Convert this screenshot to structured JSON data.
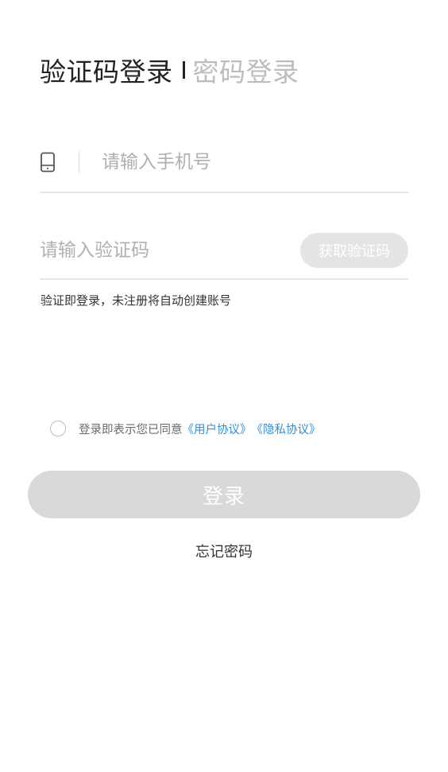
{
  "tabs": {
    "active": "验证码登录",
    "inactive": "密码登录"
  },
  "phone": {
    "icon": "phone-icon",
    "placeholder": "请输入手机号",
    "value": ""
  },
  "code": {
    "placeholder": "请输入验证码",
    "value": "",
    "get_code_label": "获取验证码"
  },
  "hint": "验证即登录，未注册将自动创建账号",
  "agreement": {
    "checked": false,
    "text": "登录即表示您已同意",
    "user_agreement": "《用户协议》",
    "privacy_agreement": "《隐私协议》"
  },
  "login_label": "登录",
  "forgot_label": "忘记密码",
  "colors": {
    "link": "#2f8fd8",
    "button_disabled": "#d9d9d9",
    "placeholder": "#b0b0b0"
  }
}
